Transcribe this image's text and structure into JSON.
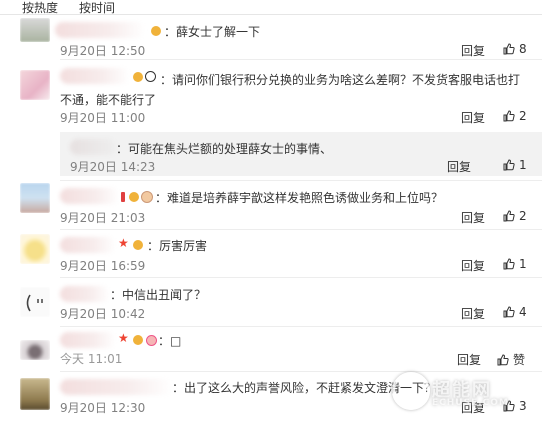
{
  "tabs": [
    "按热度",
    "按时间"
  ],
  "reply_label": "回复",
  "comments": [
    {
      "text": "：薛女士了解一下",
      "time": "9月20日 12:50",
      "likes": "8"
    },
    {
      "text_line1": "：请问你们银行积分兑换的业务为啥这么差啊？不发货客服电话也打",
      "text_line2": "不通，能不能行了",
      "time": "9月20日 11:00",
      "likes": "2"
    },
    {
      "text": "：可能在焦头烂额的处理薛女士的事情、",
      "time": "9月20日 14:23",
      "likes": "1"
    },
    {
      "text": "：难道是培养薛宇歆这样发艳照色诱做业务和上位吗？",
      "time": "9月20日 21:03",
      "likes": "2"
    },
    {
      "text": "：厉害厉害",
      "time": "9月20日 16:59",
      "likes": "1"
    },
    {
      "text": "：中信出丑闻了？",
      "time": "9月20日 10:42",
      "likes": "4"
    },
    {
      "text": "：□",
      "time": "今天 11:01",
      "likes": "赞"
    },
    {
      "text": "：出了这么大的声誉风险，不赶紧发文澄清一下？",
      "time": "9月20日 12:30",
      "likes": "3"
    }
  ],
  "watermark": {
    "main": "超能网",
    "sub": "ECHUSE.COM"
  },
  "colors": {
    "text": "#333333",
    "time": "#808080",
    "subreply_bg": "#f2f2f2",
    "divider": "#ededed"
  }
}
